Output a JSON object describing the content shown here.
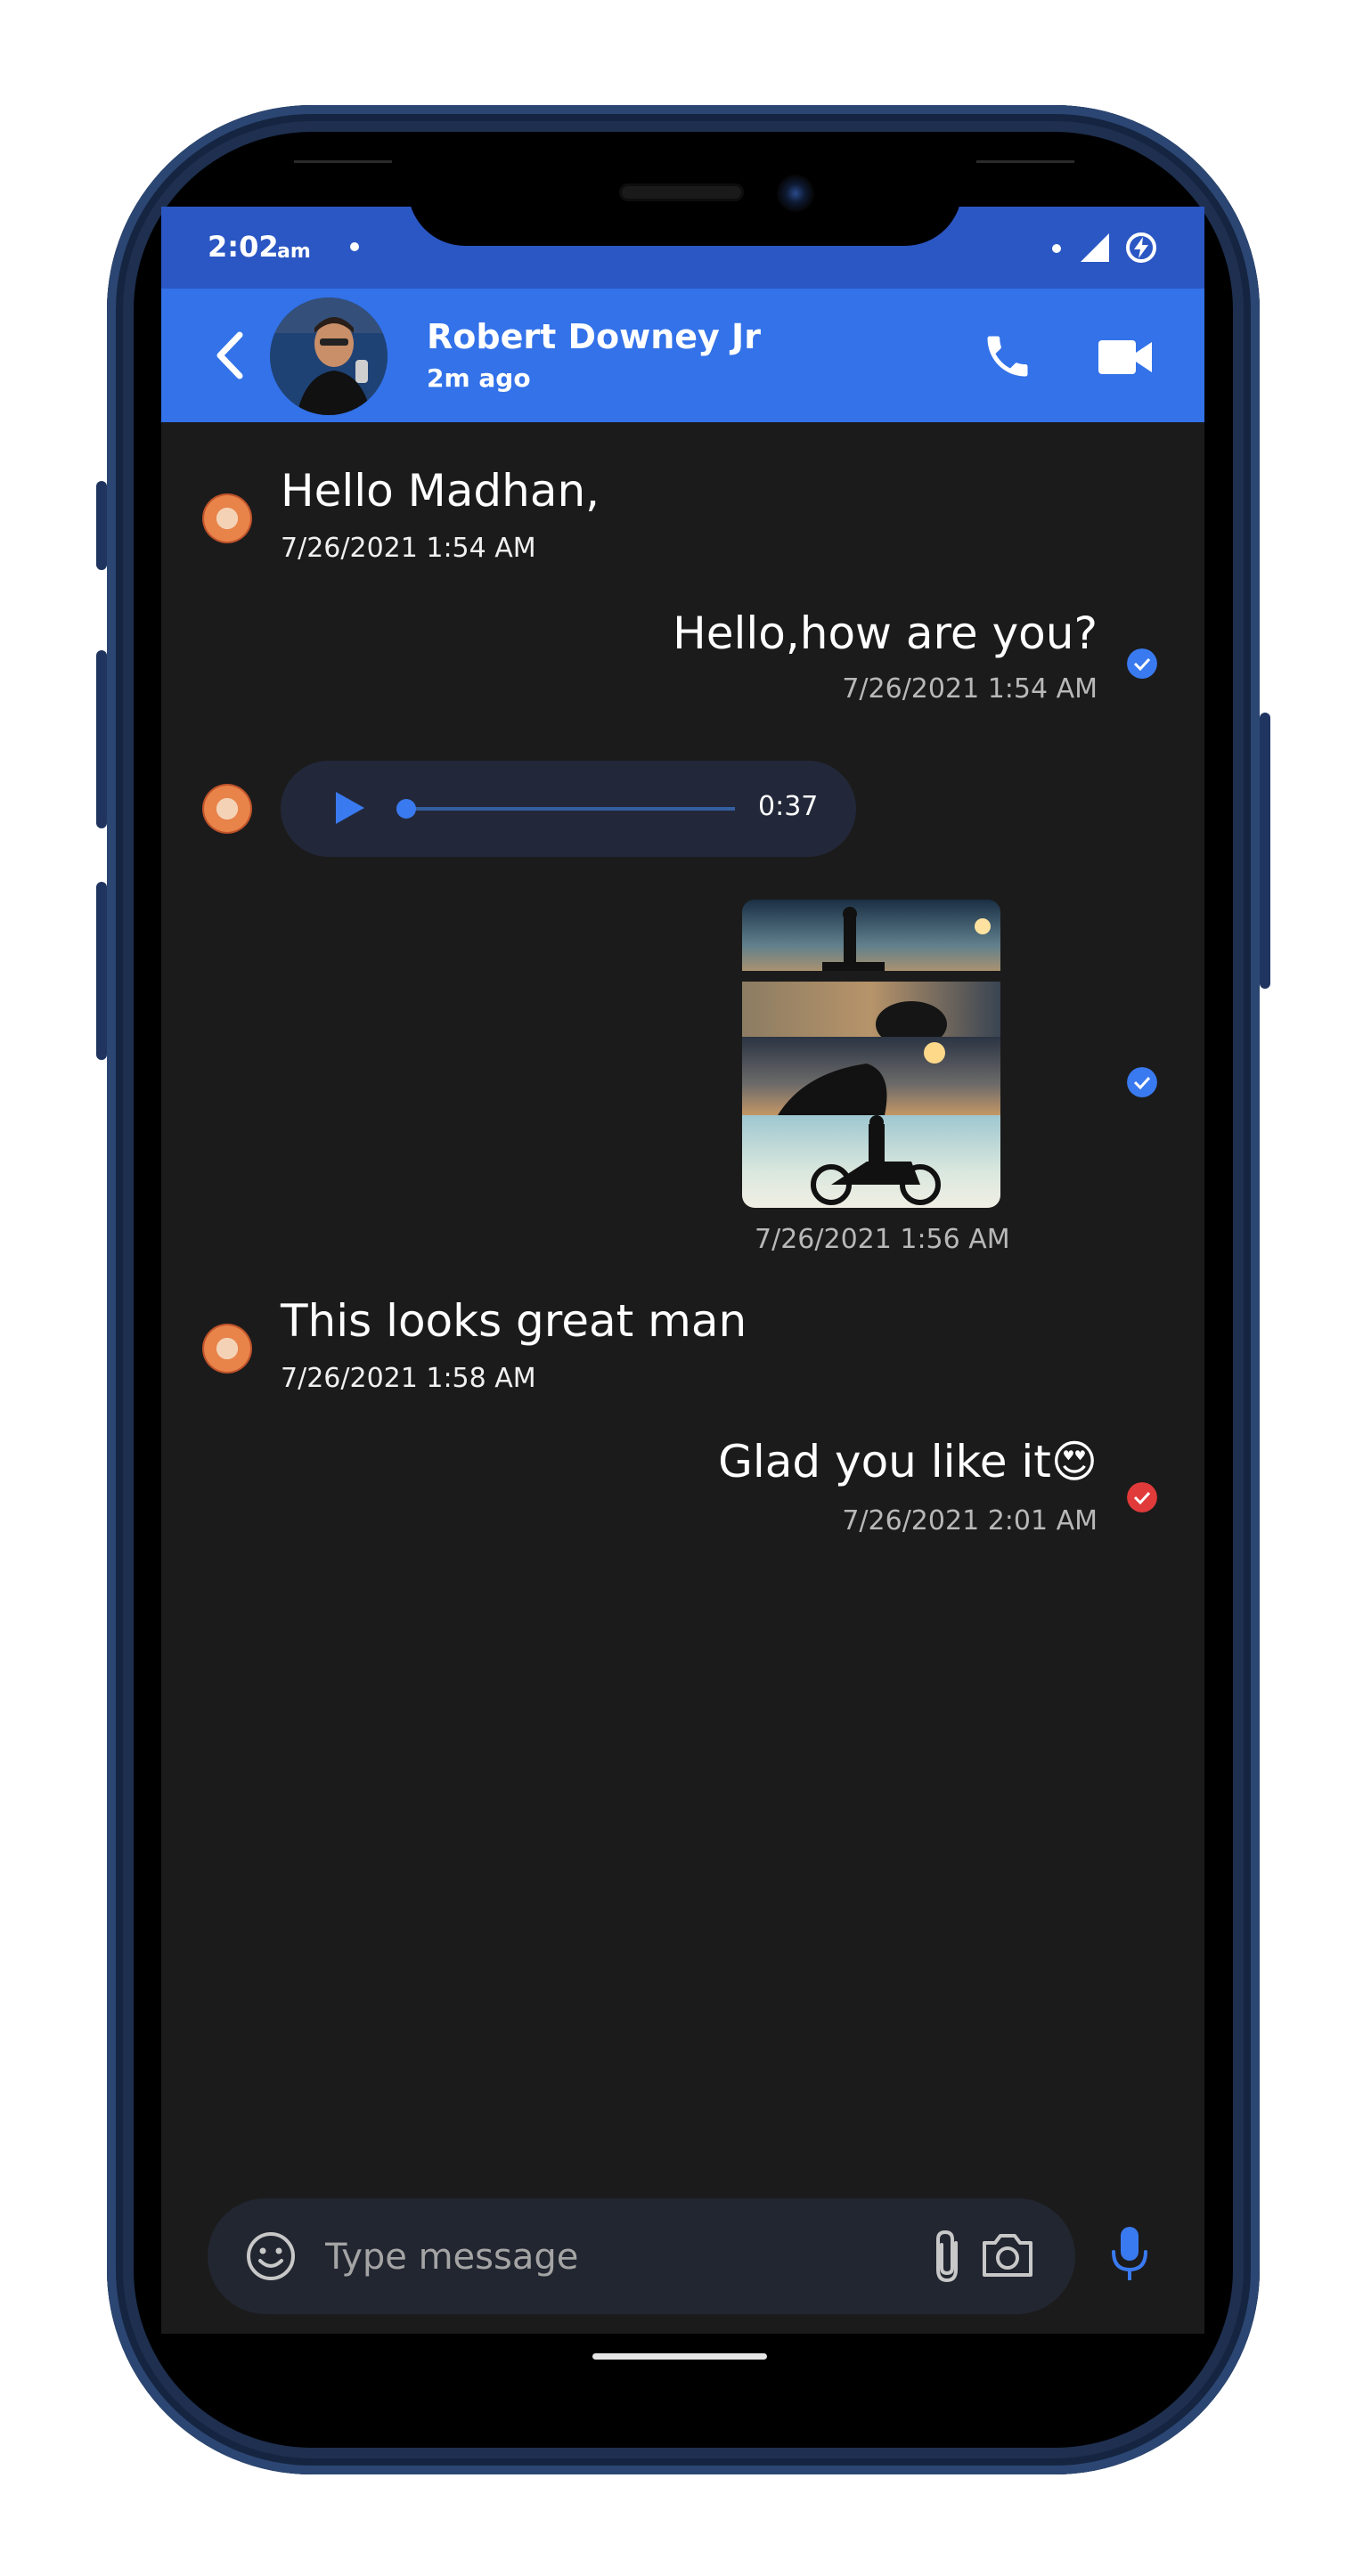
{
  "status_bar": {
    "time": "2:02",
    "ampm": "am"
  },
  "header": {
    "contact_name": "Robert Downey Jr",
    "contact_status": "2m ago"
  },
  "messages": [
    {
      "direction": "incoming",
      "type": "text",
      "text": "Hello Madhan,",
      "timestamp": "7/26/2021 1:54 AM"
    },
    {
      "direction": "outgoing",
      "type": "text",
      "text": "Hello,how are you?",
      "timestamp": "7/26/2021 1:54 AM",
      "status_color": "#3a7af0"
    },
    {
      "direction": "incoming",
      "type": "audio",
      "duration": "0:37",
      "progress": 0
    },
    {
      "direction": "outgoing",
      "type": "image",
      "timestamp": "7/26/2021 1:56 AM",
      "status_color": "#3a7af0"
    },
    {
      "direction": "incoming",
      "type": "text",
      "text": "This looks great man",
      "timestamp": "7/26/2021 1:58 AM"
    },
    {
      "direction": "outgoing",
      "type": "text",
      "text": "Glad you like it😍",
      "timestamp": "7/26/2021 2:01 AM",
      "status_color": "#e03a3a"
    }
  ],
  "input": {
    "placeholder": "Type message",
    "value": ""
  },
  "colors": {
    "status_bar": "#2b57c4",
    "app_bar": "#3372e8",
    "chat_background": "#1b1b1b",
    "accent": "#3a7af0"
  },
  "icons": [
    "back-arrow-icon",
    "phone-icon",
    "video-camera-icon",
    "check-icon",
    "play-icon",
    "emoji-icon",
    "attach-icon",
    "camera-icon",
    "mic-icon"
  ]
}
